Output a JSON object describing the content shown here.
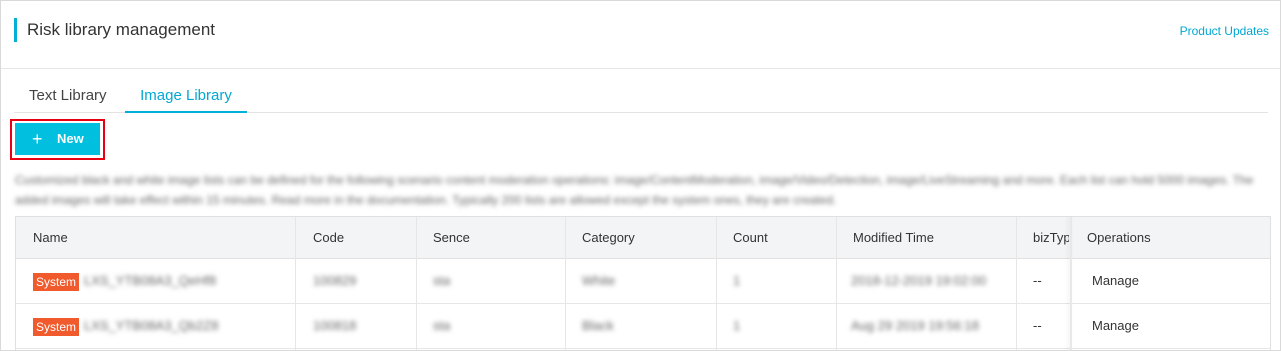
{
  "header": {
    "title": "Risk library management",
    "updates_link": "Product Updates"
  },
  "tabs": [
    {
      "label": "Text Library",
      "active": false
    },
    {
      "label": "Image Library",
      "active": true
    }
  ],
  "toolbar": {
    "new_label": "New",
    "plus_glyph": "+"
  },
  "description": "Customized black and white image lists can be defined for the following scenario content moderation operations: image/ContentModeration, image/Video/Detection, image/LiveStreaming and more. Each list can hold 5000 images. The added images will take effect within 15 minutes. Read more in the documentation. Typically 200 lists are allowed except the system ones, they are created.",
  "table": {
    "columns": [
      "Name",
      "Code",
      "Sence",
      "Category",
      "Count",
      "Modified Time",
      "bizTyp",
      "Operations"
    ],
    "rows": [
      {
        "badge": "System",
        "name": "LXS_YTB08A3_QeHf8",
        "code": "100829",
        "sence": "sta",
        "category": "White",
        "count": "1",
        "modified": "2018-12-2019 19:02:00",
        "biztype": "--",
        "operation": "Manage"
      },
      {
        "badge": "System",
        "name": "LXS_YTB08A3_Qb2Z8",
        "code": "100818",
        "sence": "sta",
        "category": "Black",
        "count": "1",
        "modified": "Aug 29 2019 19:56:18",
        "biztype": "--",
        "operation": "Manage"
      }
    ]
  },
  "colors": {
    "accent": "#00b0d8",
    "button": "#00bfdf",
    "badge": "#f05a2c",
    "highlight": "#e60012"
  }
}
